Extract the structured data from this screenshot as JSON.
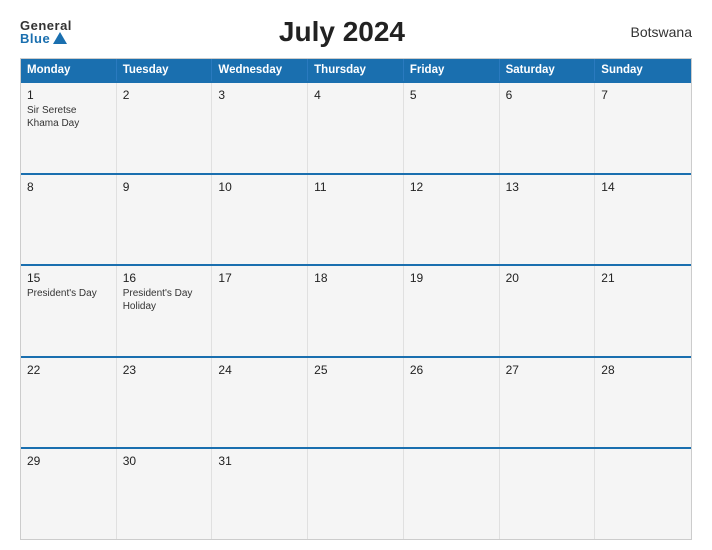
{
  "header": {
    "logo_general": "General",
    "logo_blue": "Blue",
    "title": "July 2024",
    "country": "Botswana"
  },
  "calendar": {
    "headers": [
      "Monday",
      "Tuesday",
      "Wednesday",
      "Thursday",
      "Friday",
      "Saturday",
      "Sunday"
    ],
    "weeks": [
      [
        {
          "day": "1",
          "event": "Sir Seretse Khama Day"
        },
        {
          "day": "2",
          "event": ""
        },
        {
          "day": "3",
          "event": ""
        },
        {
          "day": "4",
          "event": ""
        },
        {
          "day": "5",
          "event": ""
        },
        {
          "day": "6",
          "event": ""
        },
        {
          "day": "7",
          "event": ""
        }
      ],
      [
        {
          "day": "8",
          "event": ""
        },
        {
          "day": "9",
          "event": ""
        },
        {
          "day": "10",
          "event": ""
        },
        {
          "day": "11",
          "event": ""
        },
        {
          "day": "12",
          "event": ""
        },
        {
          "day": "13",
          "event": ""
        },
        {
          "day": "14",
          "event": ""
        }
      ],
      [
        {
          "day": "15",
          "event": "President's Day"
        },
        {
          "day": "16",
          "event": "President's Day Holiday"
        },
        {
          "day": "17",
          "event": ""
        },
        {
          "day": "18",
          "event": ""
        },
        {
          "day": "19",
          "event": ""
        },
        {
          "day": "20",
          "event": ""
        },
        {
          "day": "21",
          "event": ""
        }
      ],
      [
        {
          "day": "22",
          "event": ""
        },
        {
          "day": "23",
          "event": ""
        },
        {
          "day": "24",
          "event": ""
        },
        {
          "day": "25",
          "event": ""
        },
        {
          "day": "26",
          "event": ""
        },
        {
          "day": "27",
          "event": ""
        },
        {
          "day": "28",
          "event": ""
        }
      ],
      [
        {
          "day": "29",
          "event": ""
        },
        {
          "day": "30",
          "event": ""
        },
        {
          "day": "31",
          "event": ""
        },
        {
          "day": "",
          "event": ""
        },
        {
          "day": "",
          "event": ""
        },
        {
          "day": "",
          "event": ""
        },
        {
          "day": "",
          "event": ""
        }
      ]
    ]
  }
}
